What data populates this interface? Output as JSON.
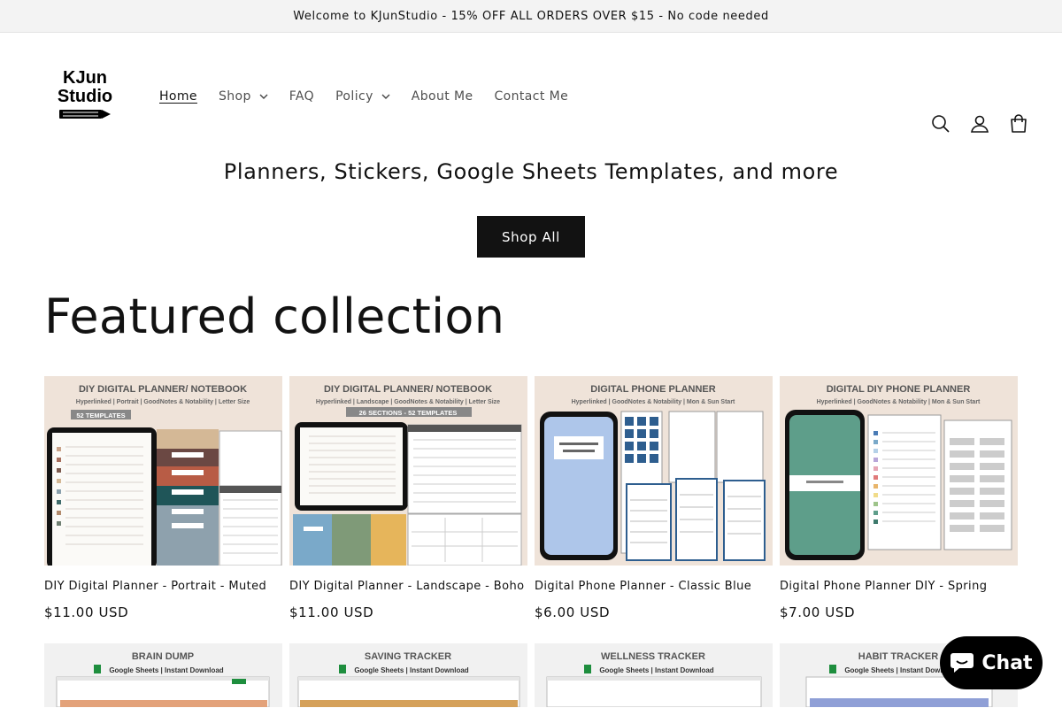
{
  "announcement": "Welcome to KJunStudio - 15% OFF ALL ORDERS OVER $15 - No code needed",
  "logo": {
    "line1": "KJun",
    "line2": "Studio"
  },
  "nav": [
    {
      "label": "Home",
      "active": true,
      "dropdown": false
    },
    {
      "label": "Shop",
      "active": false,
      "dropdown": true
    },
    {
      "label": "FAQ",
      "active": false,
      "dropdown": false
    },
    {
      "label": "Policy",
      "active": false,
      "dropdown": true
    },
    {
      "label": "About Me",
      "active": false,
      "dropdown": false
    },
    {
      "label": "Contact Me",
      "active": false,
      "dropdown": false
    }
  ],
  "header_icons": [
    "search-icon",
    "account-icon",
    "cart-icon"
  ],
  "hero": {
    "subtitle": "Planners, Stickers, Google Sheets Templates, and more",
    "button": "Shop All"
  },
  "featured": {
    "title": "Featured collection",
    "products": [
      {
        "title": "DIY Digital Planner - Portrait - Muted",
        "price": "$11.00 USD",
        "banner": "DIY DIGITAL PLANNER/ NOTEBOOK",
        "sub": "Hyperlinked | Portrait | GoodNotes & Notability | Letter Size",
        "tag": "52 TEMPLATES"
      },
      {
        "title": "DIY Digital Planner - Landscape - Boho",
        "price": "$11.00 USD",
        "banner": "DIY DIGITAL PLANNER/ NOTEBOOK",
        "sub": "Hyperlinked | Landscape | GoodNotes & Notability | Letter Size",
        "tag": "26 SECTIONS - 52 TEMPLATES"
      },
      {
        "title": "Digital Phone Planner - Classic Blue",
        "price": "$6.00 USD",
        "banner": "DIGITAL PHONE PLANNER",
        "sub": "Hyperlinked | GoodNotes & Notability | Mon & Sun Start",
        "tag": ""
      },
      {
        "title": "Digital Phone Planner DIY - Spring",
        "price": "$7.00 USD",
        "banner": "DIGITAL DIY PHONE PLANNER",
        "sub": "Hyperlinked | GoodNotes & Notability | Mon & Sun Start",
        "tag": ""
      }
    ],
    "row2": [
      {
        "banner": "BRAIN DUMP",
        "sub": "Google Sheets | Instant Download"
      },
      {
        "banner": "SAVING TRACKER",
        "sub": "Google Sheets | Instant Download"
      },
      {
        "banner": "WELLNESS TRACKER",
        "sub": "Google Sheets | Instant Download"
      },
      {
        "banner": "HABIT TRACKER",
        "sub": "Google Sheets | Instant Download"
      }
    ]
  },
  "chat": {
    "label": "Chat"
  },
  "colors": {
    "accent": "#121212",
    "thumb_bg": "#efe3d9",
    "sheets_bg": "#f1f1f1",
    "chat_bg": "#000000"
  }
}
